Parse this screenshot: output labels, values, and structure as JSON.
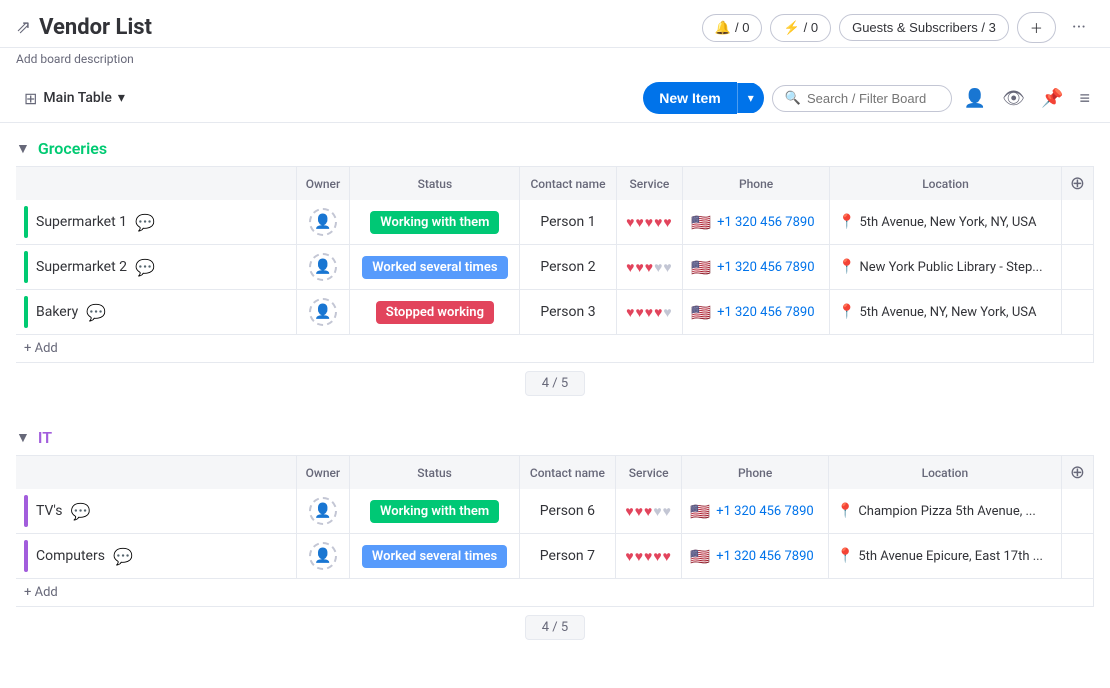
{
  "app": {
    "title": "Vendor List",
    "board_description": "Add board description"
  },
  "header": {
    "activity_count": "/ 0",
    "activity2_count": "/ 0",
    "guests_label": "Guests & Subscribers / 3",
    "more_tooltip": "More options"
  },
  "toolbar": {
    "main_table_label": "Main Table",
    "new_item_label": "New Item",
    "search_placeholder": "Search / Filter Board"
  },
  "groups": [
    {
      "id": "groceries",
      "title": "Groceries",
      "color": "green",
      "columns": [
        "Owner",
        "Status",
        "Contact name",
        "Service",
        "Phone",
        "Location"
      ],
      "rows": [
        {
          "name": "Supermarket 1",
          "owner": "",
          "status": "Working with them",
          "status_color": "green",
          "contact": "Person 1",
          "hearts": 5,
          "phone": "+1 320 456 7890",
          "location": "5th Avenue, New York, NY, USA"
        },
        {
          "name": "Supermarket 2",
          "owner": "",
          "status": "Worked several times",
          "status_color": "blue",
          "contact": "Person 2",
          "hearts": 3,
          "phone": "+1 320 456 7890",
          "location": "New York Public Library - Step..."
        },
        {
          "name": "Bakery",
          "owner": "",
          "status": "Stopped working",
          "status_color": "red",
          "contact": "Person 3",
          "hearts": 4,
          "phone": "+1 320 456 7890",
          "location": "5th Avenue, NY, New York, USA"
        }
      ],
      "add_label": "+ Add",
      "summary": "4 / 5"
    },
    {
      "id": "it",
      "title": "IT",
      "color": "purple",
      "columns": [
        "Owner",
        "Status",
        "Contact name",
        "Service",
        "Phone",
        "Location"
      ],
      "rows": [
        {
          "name": "TV's",
          "owner": "",
          "status": "Working with them",
          "status_color": "green",
          "contact": "Person 6",
          "hearts": 3,
          "phone": "+1 320 456 7890",
          "location": "Champion Pizza 5th Avenue, ..."
        },
        {
          "name": "Computers",
          "owner": "",
          "status": "Worked several times",
          "status_color": "blue",
          "contact": "Person 7",
          "hearts": 5,
          "phone": "+1 320 456 7890",
          "location": "5th Avenue Epicure, East 17th ..."
        }
      ],
      "add_label": "+ Add",
      "summary": "4 / 5"
    }
  ]
}
